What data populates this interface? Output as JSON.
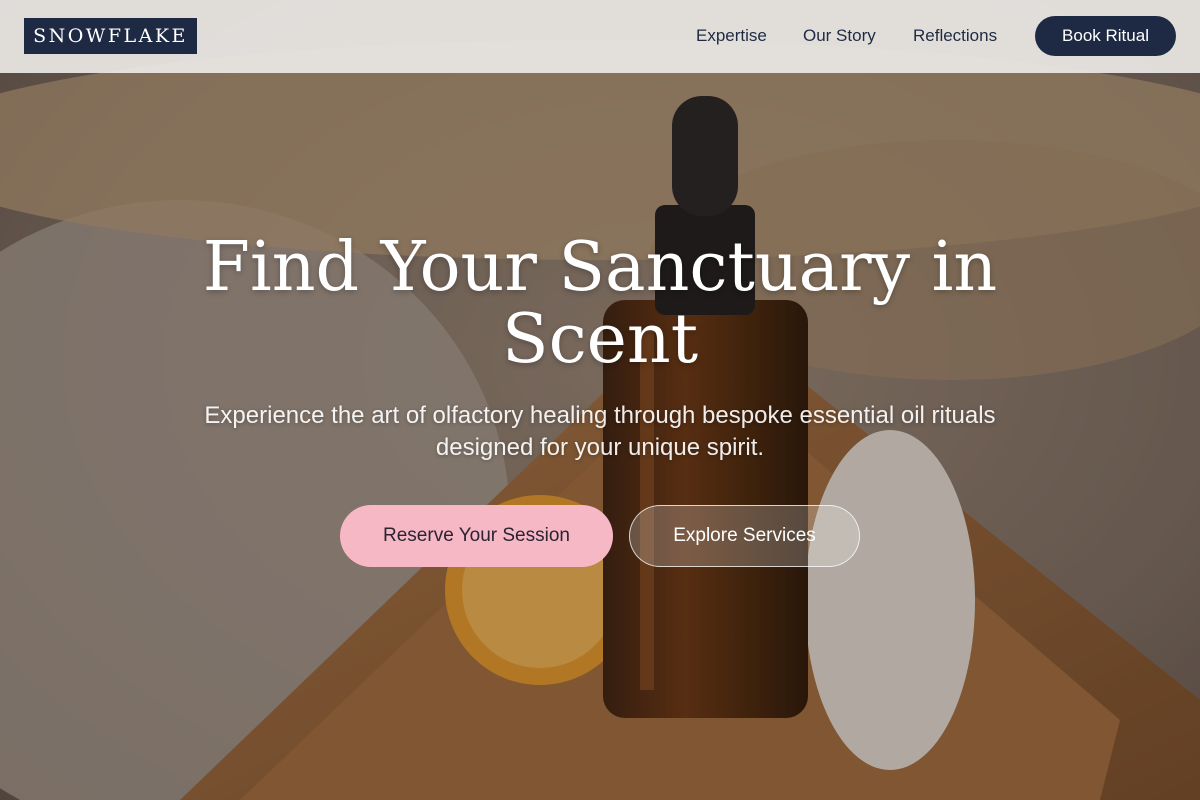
{
  "header": {
    "logo": "SNOWFLAKE",
    "nav": {
      "expertise": "Expertise",
      "our_story": "Our Story",
      "reflections": "Reflections"
    },
    "cta": "Book Ritual"
  },
  "hero": {
    "title": "Find Your Sanctuary in Scent",
    "subtitle": "Experience the art of olfactory healing through bespoke essential oil rituals designed for your unique spirit.",
    "primary_button": "Reserve Your Session",
    "secondary_button": "Explore Services"
  },
  "colors": {
    "navy": "#1e2a44",
    "pink": "#f7b8c6",
    "header_bg": "#ece9e6"
  }
}
